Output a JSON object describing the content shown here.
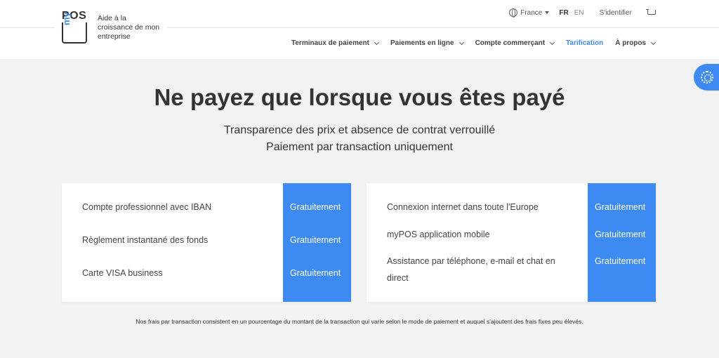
{
  "brand": {
    "logo_pos": "POS",
    "logo_my": "my",
    "tagline": "Aide à la croissance de mon entreprise"
  },
  "top_bar": {
    "country": "France",
    "lang_fr": "FR",
    "lang_en": "EN",
    "login": "S'identifier"
  },
  "nav": {
    "items": [
      {
        "label": "Terminaux de paiement"
      },
      {
        "label": "Paiements en ligne"
      },
      {
        "label": "Compte commerçant"
      },
      {
        "label": "Tarification"
      },
      {
        "label": "À propos"
      }
    ]
  },
  "hero": {
    "title": "Ne payez que lorsque vous êtes payé",
    "subtitle_1": "Transparence des prix et absence de contrat verrouillé",
    "subtitle_2": "Paiement par transaction uniquement"
  },
  "pricing": {
    "left": [
      {
        "label": "Compte professionnel avec IBAN",
        "price": "Gratuitement"
      },
      {
        "label": "Règlement instantané des fonds",
        "price": "Gratuitement"
      },
      {
        "label": "Carte VISA business",
        "price": "Gratuitement"
      }
    ],
    "right": [
      {
        "label": "Connexion internet dans toute l'Europe",
        "price": "Gratuitement"
      },
      {
        "label": "myPOS application mobile",
        "price": "Gratuitement"
      },
      {
        "label": "Assistance par téléphone, e-mail et chat en direct",
        "price": "Gratuitement"
      }
    ]
  },
  "footnote": "Nos frais par transaction consistent en un pourcentage du montant de la transaction qui varie selon le mode de paiement et auquel s'ajoutent des frais fixes peu élevés.",
  "colors": {
    "accent": "#3d8bf2",
    "background": "#f2f2f2",
    "text": "#333333"
  },
  "icons": [
    "globe-icon",
    "caret-down-icon",
    "cart-icon",
    "chevron-down-icon",
    "gear-icon"
  ]
}
